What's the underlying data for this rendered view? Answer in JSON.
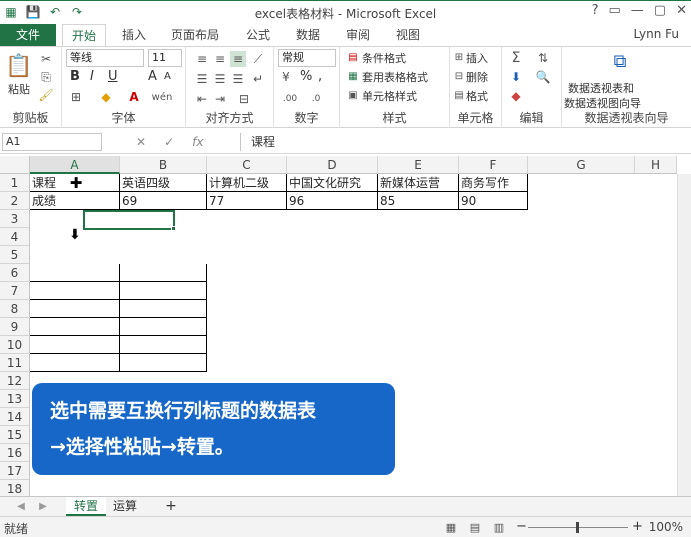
{
  "window": {
    "title": "excel表格材料 - Microsoft Excel",
    "controls": [
      "?",
      "▭",
      "—",
      "▢",
      "✕"
    ]
  },
  "ribbon_tabs": {
    "file": "文件",
    "tabs": [
      "开始",
      "插入",
      "页面布局",
      "公式",
      "数据",
      "审阅",
      "视图"
    ],
    "user": "Lynn Fu"
  },
  "ribbon": {
    "clipboard": {
      "label": "剪贴板",
      "paste": "粘贴"
    },
    "font": {
      "label": "字体",
      "name": "等线",
      "size": "11",
      "bold": "B",
      "italic": "I",
      "underline": "U",
      "grow": "A",
      "shrink": "A"
    },
    "align": {
      "label": "对齐方式"
    },
    "number": {
      "label": "数字",
      "format": "常规",
      "percent": "%",
      "comma": ","
    },
    "styles": {
      "label": "样式",
      "conditional": "条件格式",
      "table": "套用表格格式",
      "cell": "单元格样式"
    },
    "cells": {
      "label": "单元格",
      "insert": "插入",
      "delete": "删除",
      "format": "格式"
    },
    "editing": {
      "label": "编辑"
    },
    "pivot": {
      "label": "数据透视表向导",
      "btn_line1": "数据透视表和",
      "btn_line2": "数据透视图向导"
    }
  },
  "formula_bar": {
    "name_box": "A1",
    "fx": "fx",
    "cancel": "✕",
    "enter": "✓",
    "content": "课程"
  },
  "columns": [
    "A",
    "B",
    "C",
    "D",
    "E",
    "F",
    "G",
    "H"
  ],
  "rows": [
    "1",
    "2",
    "3",
    "4",
    "5",
    "6",
    "7",
    "8",
    "9",
    "10",
    "11",
    "12",
    "13",
    "14",
    "15",
    "16",
    "17",
    "18"
  ],
  "table": {
    "row1": [
      "课程",
      "英语四级",
      "计算机二级",
      "中国文化研究",
      "新媒体运营",
      "商务写作"
    ],
    "row2": [
      "成绩",
      "69",
      "77",
      "96",
      "85",
      "90"
    ]
  },
  "callout": {
    "line1": "选中需要互换行列标题的数据表",
    "line2": "→选择性粘贴→转置。"
  },
  "sheets": {
    "tabs": [
      "转置",
      "运算"
    ],
    "add": "+"
  },
  "status": {
    "text": "就绪",
    "zoom": "100%",
    "minus": "−",
    "plus": "+"
  }
}
